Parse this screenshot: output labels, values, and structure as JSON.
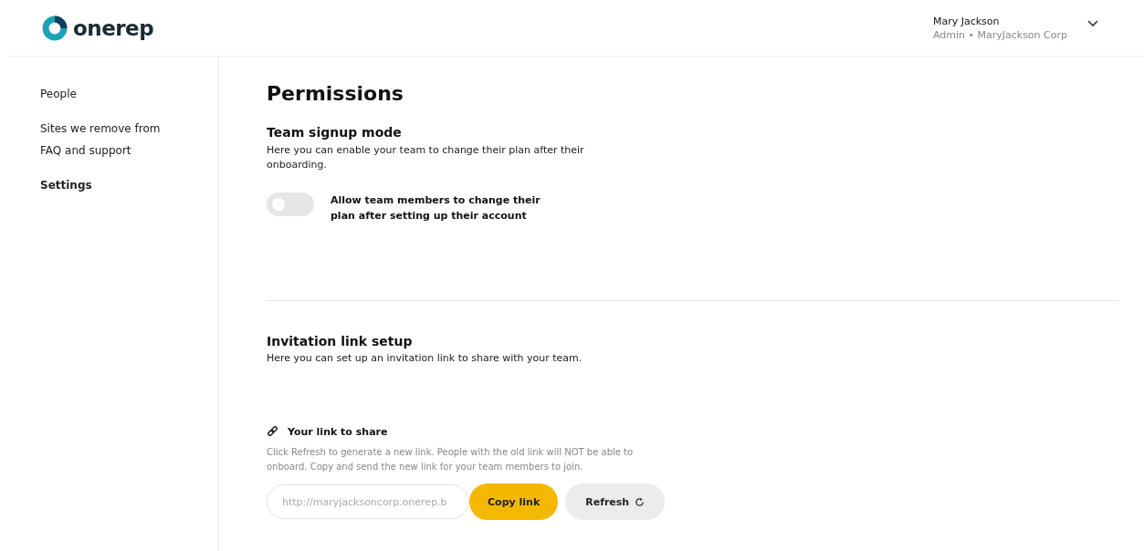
{
  "header": {
    "brand": "onerep",
    "user": {
      "name": "Mary Jackson",
      "role": "Admin • MaryJackson Corp"
    }
  },
  "sidebar": {
    "items": [
      {
        "label": "People",
        "selected": false
      },
      {
        "label": "Sites we remove from",
        "selected": false
      },
      {
        "label": "FAQ and support",
        "selected": false
      },
      {
        "label": "Settings",
        "selected": true
      }
    ]
  },
  "page": {
    "title": "Permissions",
    "signup": {
      "title": "Team signup mode",
      "description": "Here you can enable your team to change their plan after their onboarding.",
      "toggle": {
        "label": "Allow team members to change their plan after setting up their account",
        "on": false
      }
    },
    "invitation": {
      "title": "Invitation link setup",
      "description": "Here you can set up an invitation link to share with your team.",
      "link_title": "Your link to share",
      "link_help": "Click Refresh to generate a new link. People with the old link will NOT be able to onboard. Copy and send the new link for your team members to join.",
      "link_value": "http://maryjacksoncorp.onerep.b",
      "copy_button": "Copy link",
      "refresh_button": "Refresh"
    }
  }
}
